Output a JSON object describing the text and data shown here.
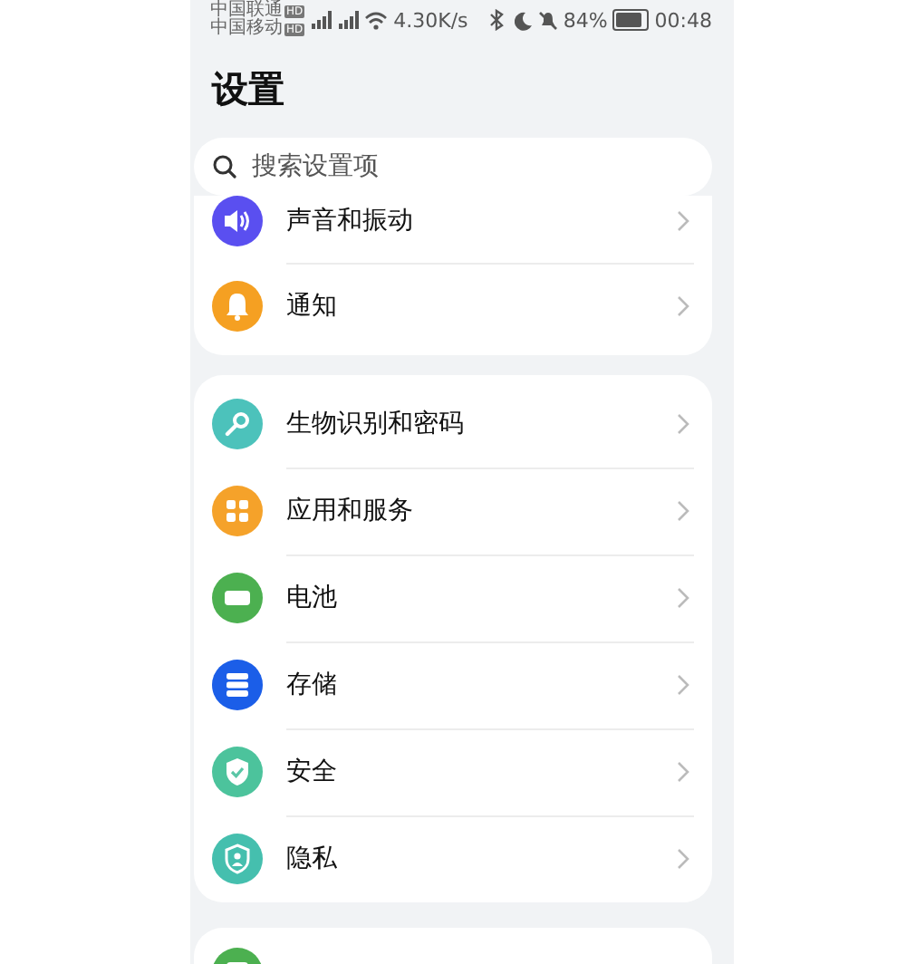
{
  "status_bar": {
    "carriers": [
      {
        "name": "中国联通",
        "badge": "HD"
      },
      {
        "name": "中国移动",
        "badge": "HD"
      }
    ],
    "speed": "4.30K/s",
    "battery_text": "84%",
    "battery": {
      "level": 0.84
    },
    "time": "00:48"
  },
  "title": "设置",
  "search": {
    "placeholder": "搜索设置项"
  },
  "groups": [
    {
      "items": [
        {
          "label": "声音和振动",
          "color": "#5a4ff0"
        },
        {
          "label": "通知",
          "color": "#f5a022"
        }
      ]
    },
    {
      "items": [
        {
          "label": "生物识别和密码",
          "color": "#4cc2bb"
        },
        {
          "label": "应用和服务",
          "color": "#f5a22a"
        },
        {
          "label": "电池",
          "color": "#4cb050"
        },
        {
          "label": "存储",
          "color": "#1b5ee8"
        },
        {
          "label": "安全",
          "color": "#4cc39c"
        },
        {
          "label": "隐私",
          "color": "#45bfae"
        }
      ]
    },
    {
      "items": [
        {
          "color": "#4cb050"
        }
      ]
    }
  ]
}
